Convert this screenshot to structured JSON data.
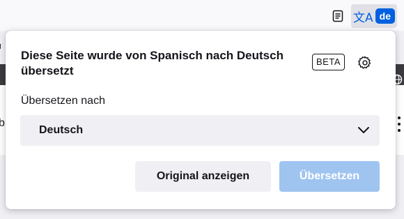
{
  "toolbar": {
    "translate_lang_badge": "de",
    "translate_glyph": "文A"
  },
  "panel": {
    "title": "Diese Seite wurde von Spanisch nach Deutsch übersetzt",
    "beta_label": "BETA",
    "translate_to_label": "Übersetzen nach",
    "target_language": "Deutsch",
    "show_original_label": "Original anzeigen",
    "translate_label": "Übersetzen"
  },
  "background": {
    "edge_letter": "b"
  },
  "colors": {
    "accent": "#0061e0",
    "translate_button_disabled": "#9fc4f0",
    "secondary_button": "#f0f0f4",
    "text": "#15141a"
  }
}
